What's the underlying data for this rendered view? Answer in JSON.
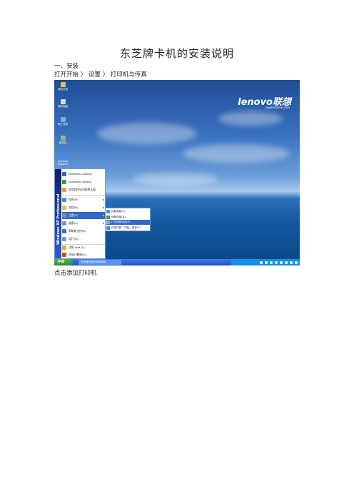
{
  "doc": {
    "title": "东芝牌卡机的安装说明",
    "section": "一、安装",
    "instruction": "打开开始 〉 设置 〉 打印机与传真",
    "caption": "点击添加打印机"
  },
  "screenshot": {
    "brand": "lenovo联想",
    "brand_url": "www.lenovo.com",
    "desktop_icons": [
      {
        "label": "我的文档",
        "icon": "folder-icon",
        "color": "#e8c04a"
      },
      {
        "label": "我的电脑",
        "icon": "computer-icon",
        "color": "#cfd9e8"
      },
      {
        "label": "网上邻居",
        "icon": "network-icon",
        "color": "#6bb0e8"
      },
      {
        "label": "回收站",
        "icon": "recycle-bin-icon",
        "color": "#8fbf6a"
      },
      {
        "label": "Internet Explorer",
        "icon": "ie-icon",
        "color": "#3a8ee8"
      }
    ],
    "start_menu": {
      "strip_text": "Windows XP Professional",
      "items": [
        {
          "label": "Windows Catalog",
          "icon": "catalog-icon",
          "color": "#2d66c9"
        },
        {
          "label": "Windows Update",
          "icon": "windows-update-icon",
          "color": "#3aa13a"
        },
        {
          "label": "设定程序访问和默认值",
          "icon": "defaults-icon",
          "color": "#e6a12c"
        },
        {
          "label": "程序(P)",
          "icon": "programs-icon",
          "color": "#4f86d6",
          "arrow": "▸"
        },
        {
          "label": "文档(D)",
          "icon": "documents-icon",
          "color": "#e8c04a",
          "arrow": "▸"
        },
        {
          "label": "设置(S)",
          "icon": "settings-icon",
          "color": "#7c8fb0",
          "arrow": "▸"
        },
        {
          "label": "搜索(C)",
          "icon": "search-icon",
          "color": "#6c9be0",
          "arrow": "▸"
        },
        {
          "label": "帮助和支持(H)",
          "icon": "help-icon",
          "color": "#2d77d6"
        },
        {
          "label": "运行(R)...",
          "icon": "run-icon",
          "color": "#8a9ab5"
        },
        {
          "label": "注销 root (L)...",
          "icon": "logoff-icon",
          "color": "#e8a93a"
        },
        {
          "label": "关闭计算机(U)...",
          "icon": "shutdown-icon",
          "color": "#d6442c"
        }
      ]
    },
    "settings_submenu": [
      {
        "label": "控制面板(C)",
        "icon": "control-panel-icon",
        "color": "#5a8ad8"
      },
      {
        "label": "网络连接(N)",
        "icon": "network-connections-icon",
        "color": "#3ea04a"
      },
      {
        "label": "打印机和传真(P)",
        "icon": "printer-icon",
        "color": "#9aa8c2"
      },
      {
        "label": "任务栏和「开始」菜单(T)",
        "icon": "taskbar-icon",
        "color": "#4f7fd0"
      }
    ],
    "taskbar": {
      "start_label": "开始",
      "active_window": "东芝牌卡机的安装说明"
    }
  }
}
